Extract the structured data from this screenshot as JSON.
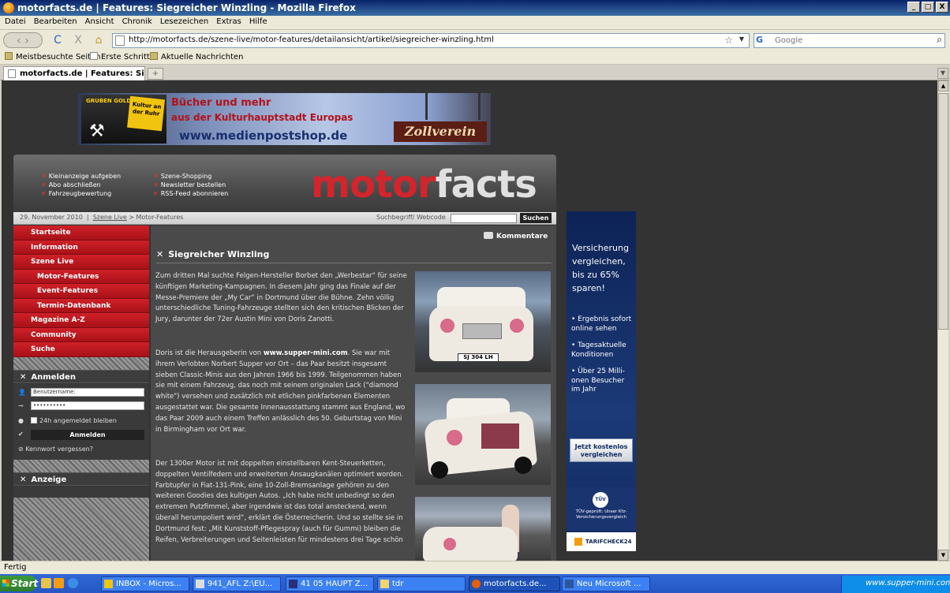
{
  "window": {
    "title": "motorfacts.de | Features: Siegreicher Winzling - Mozilla Firefox",
    "min": "_",
    "max": "□",
    "close": "X"
  },
  "menu": [
    "Datei",
    "Bearbeiten",
    "Ansicht",
    "Chronik",
    "Lesezeichen",
    "Extras",
    "Hilfe"
  ],
  "nav": {
    "url": "http://motorfacts.de/szene-live/motor-features/detailansicht/artikel/siegreicher-winzling.html",
    "search_placeholder": "Google",
    "reload": "C",
    "stop": "X",
    "home": "⌂"
  },
  "bookmarks": [
    "Meistbesuchte Seiten",
    "Erste Schritte",
    "Aktuelle Nachrichten"
  ],
  "tab": {
    "label": "motorfacts.de | Features: Sieg...",
    "new": "+"
  },
  "top_banner": {
    "book_label": "GRUBEN GOLD",
    "book_sticker": "Kultur an der Ruhr",
    "line1": "Bücher und mehr",
    "line2": "aus der Kulturhauptstadt Europas",
    "url": "www.medienpostshop.de",
    "brand": "Zollverein"
  },
  "site": {
    "header_links_left": [
      "Kleinanzeige aufgeben",
      "Abo abschließen",
      "Fahrzeugbewertung"
    ],
    "header_links_right": [
      "Szene-Shopping",
      "Newsletter bestellen",
      "RSS-Feed abonnieren"
    ],
    "logo_motor": "motor",
    "logo_facts": "facts",
    "date": "29. November 2010",
    "crumb_sep": "|",
    "crumb_link": "Szene Live",
    "crumb_rest": "> Motor-Features",
    "search_label": "Suchbegriff/ Webcode",
    "search_button": "Suchen"
  },
  "leftnav": [
    {
      "label": "Startseite",
      "sub": false
    },
    {
      "label": "Information",
      "sub": false
    },
    {
      "label": "Szene Live",
      "sub": false
    },
    {
      "label": "Motor-Features",
      "sub": true
    },
    {
      "label": "Event-Features",
      "sub": true
    },
    {
      "label": "Termin-Datenbank",
      "sub": true
    },
    {
      "label": "Magazine A-Z",
      "sub": false
    },
    {
      "label": "Community",
      "sub": false
    },
    {
      "label": "Suche",
      "sub": false
    }
  ],
  "login": {
    "title": "Anmelden",
    "user_placeholder": "Benutzername:",
    "password_mask": "••••••••••",
    "remember": "24h angemeldet bleiben",
    "button": "Anmelden",
    "forgot": "Kennwort vergessen?"
  },
  "anzeige_title": "Anzeige",
  "article": {
    "comments": "Kommentare",
    "title": "Siegreicher Winzling",
    "p1": "Zum dritten Mal suchte Felgen-Hersteller Borbet den „Werbestar“ für seine künftigen Marketing-Kampagnen. In diesem Jahr ging das Finale auf der Messe-Premiere der „My Car“ in Dortmund über die Bühne. Zehn völlig unterschiedliche Tuning-Fahrzeuge stellten sich den kritischen Blicken der Jury, darunter der 72er Austin Mini von Doris Zanotti.",
    "p2_pre": "Doris ist die Herausgeberin von ",
    "p2_link": "www.supper-mini.com",
    "p2_post": ". Sie war mit ihrem Verlobten Norbert Supper vor Ort – das Paar besitzt insgesamt sieben Classic-Minis aus den Jahren 1966 bis 1999. Teilgenommen haben sie mit einem Fahrzeug, das noch mit seinem originalen Lack (\"diamond white\") versehen und zusätzlich mit etlichen pinkfarbenen Elementen ausgestattet war. Die gesamte Innenausstattung stammt aus England, wo das Paar 2009 auch einem Treffen anlässlich des 50. Geburtstag von Mini in Birmingham vor Ort war.",
    "p3": "Der 1300er Motor ist mit doppelten einstellbaren Kent-Steuerketten, doppelten Ventilfedern und erweiterten Ansaugkanälen optimiert worden. Farbtupfer in Fiat-131-Pink, eine 10-Zoll-Bremsanlage gehören zu den weiteren Goodies des kultigen Autos. „Ich habe nicht unbedingt so den extremen Putzfimmel, aber irgendwie ist das total ansteckend, wenn überall herumpoliert wird“, erklärt die Österreicherin. Und so stellte sie in Dortmund fest: „Mit Kunststoff-Pflegespray (auch für Gummi) bleiben die Reifen, Verbreiterungen und Seitenleisten für mindestens drei Tage schön",
    "plate": "SJ 304 LH"
  },
  "right_ad": {
    "headline": [
      "Versicherung",
      "vergleichen,",
      "bis zu 65%",
      "sparen!"
    ],
    "bullets": [
      "• Ergebnis sofort online sehen",
      "• Tagesaktuelle Konditionen",
      "• Über 25 Milli-onen Besucher im Jahr"
    ],
    "cta": "Jetzt kostenlos vergleichen",
    "tuv_logo": "TÜV",
    "tuv_text": "TÜV-geprüft: Unser Kfz-Versicherungsvergleich",
    "brand": "TARIFCHECK24"
  },
  "status": "Fertig",
  "taskbar": {
    "start": "Start",
    "items": [
      "INBOX - Micros...",
      "941_AFL Z:\\EU...",
      "41 05 HAUPT Z...",
      "tdr",
      "motorfacts.de...",
      "Neu Microsoft ..."
    ],
    "tray": "www.supper-mini.com"
  }
}
